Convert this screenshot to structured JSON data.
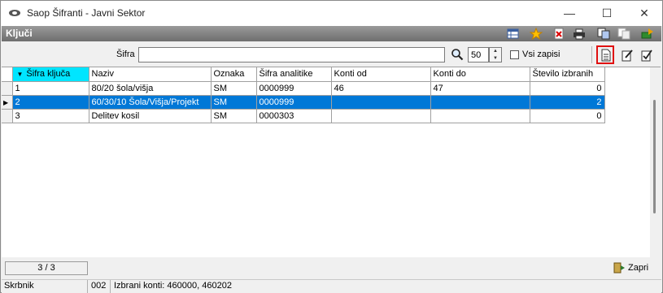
{
  "window": {
    "title": "Saop Šifranti - Javni Sektor",
    "minimize": "—",
    "maximize": "☐",
    "close": "✕"
  },
  "header": {
    "title": "Ključi"
  },
  "toolbar_icons": [
    "table-edit-icon",
    "star-icon",
    "delete-icon",
    "print-icon",
    "copy-icon",
    "paste-icon",
    "export-icon"
  ],
  "search": {
    "label": "Šifra",
    "value": "",
    "count": "50",
    "all_label": "Vsi zapisi",
    "all_checked": false
  },
  "grid": {
    "columns": [
      "Šifra ključa",
      "Naziv",
      "Oznaka",
      "Šifra analitike",
      "Konti od",
      "Konti do",
      "Število izbranih"
    ],
    "rows": [
      {
        "sifra": "1",
        "naziv": "80/20 šola/višja",
        "oznaka": "SM",
        "analitika": "0000999",
        "konti_od": "46",
        "konti_do": "47",
        "stevilo": "0"
      },
      {
        "sifra": "2",
        "naziv": "60/30/10 Šola/Višja/Projekt",
        "oznaka": "SM",
        "analitika": "0000999",
        "konti_od": "",
        "konti_do": "",
        "stevilo": "2"
      },
      {
        "sifra": "3",
        "naziv": "Delitev kosil",
        "oznaka": "SM",
        "analitika": "0000303",
        "konti_od": "",
        "konti_do": "",
        "stevilo": "0"
      }
    ],
    "selected_row": 2
  },
  "footer": {
    "counter": "3 / 3",
    "close_label": "Zapri"
  },
  "statusbar": {
    "user": "Skrbnik",
    "code": "002",
    "info": "Izbrani konti: 460000, 460202"
  },
  "colors": {
    "selection": "#0078d7",
    "sorted_header": "#00e5ff",
    "highlight_border": "#e01010"
  }
}
